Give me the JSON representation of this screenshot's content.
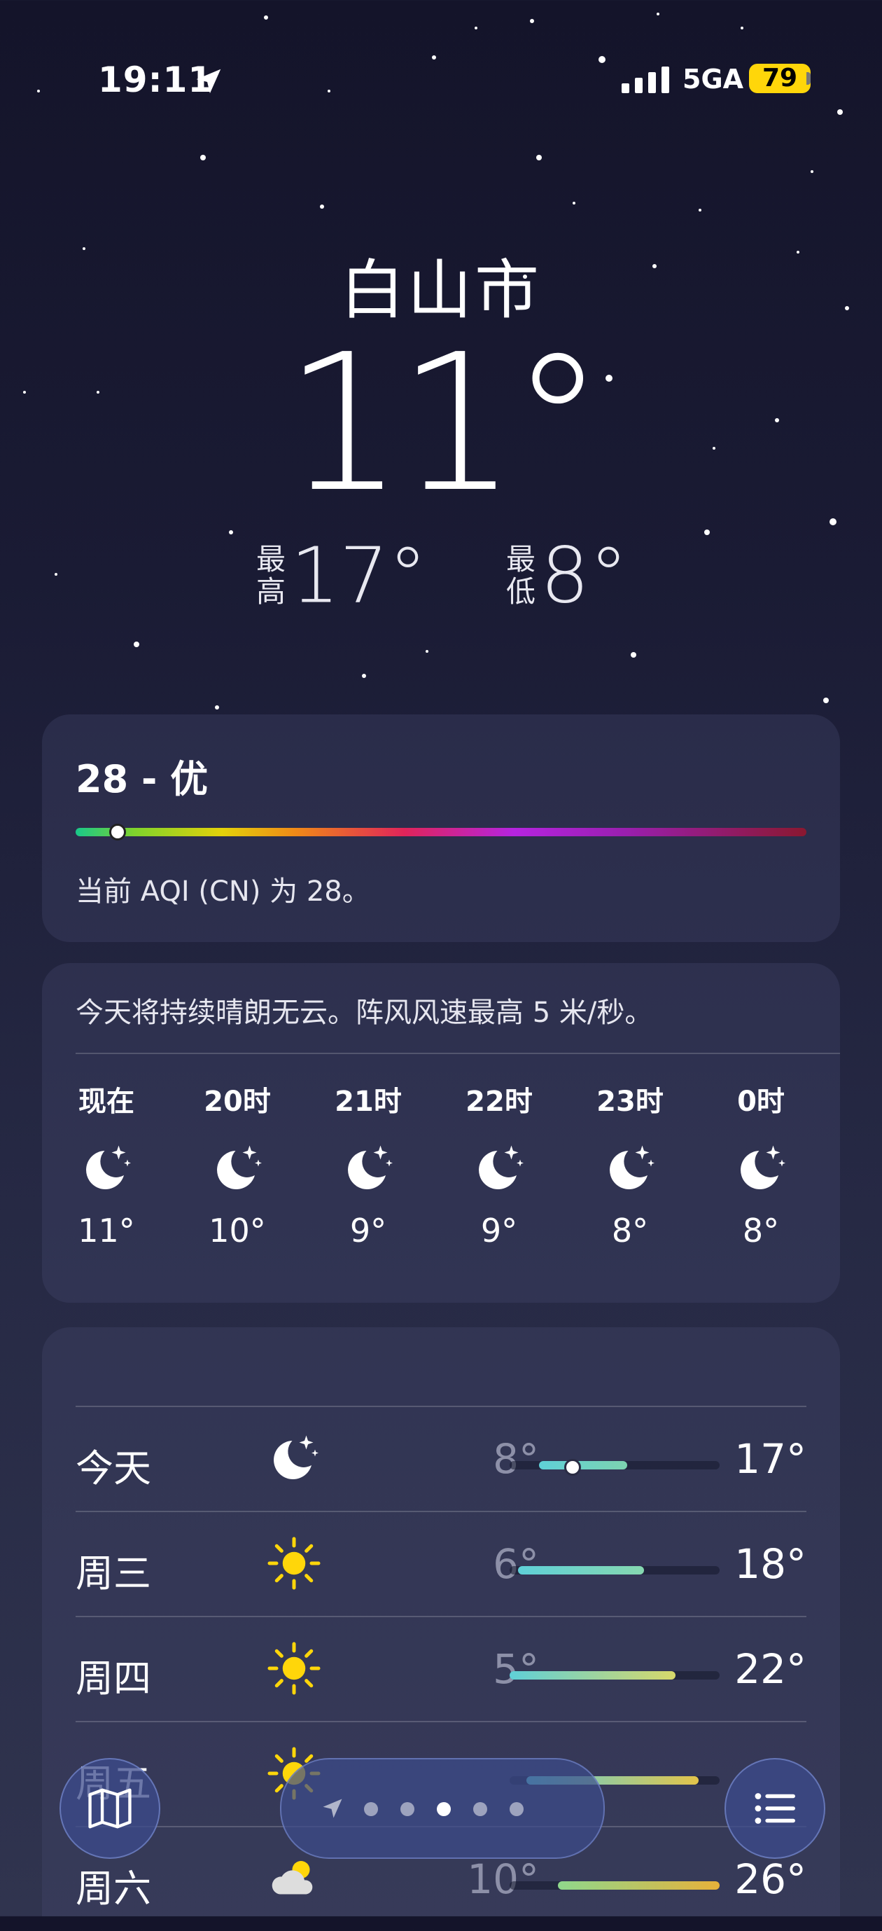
{
  "status": {
    "time": "19:11",
    "network": "5GA",
    "battery": "79"
  },
  "header": {
    "city": "白山市",
    "temp": "11°",
    "high_label": "最高",
    "high": "17°",
    "low_label": "最低",
    "low": "8°"
  },
  "aqi": {
    "title": "28 - 优",
    "description": "当前 AQI (CN) 为 28。",
    "level": 0.055
  },
  "hourly": {
    "summary": "今天将持续晴朗无云。阵风风速最高 5 米/秒。",
    "items": [
      {
        "label": "现在",
        "icon": "moon-stars-icon",
        "temp": "11°"
      },
      {
        "label": "20时",
        "icon": "moon-stars-icon",
        "temp": "10°"
      },
      {
        "label": "21时",
        "icon": "moon-stars-icon",
        "temp": "9°"
      },
      {
        "label": "22时",
        "icon": "moon-stars-icon",
        "temp": "9°"
      },
      {
        "label": "23时",
        "icon": "moon-stars-icon",
        "temp": "8°"
      },
      {
        "label": "0时",
        "icon": "moon-stars-icon",
        "temp": "8°"
      }
    ]
  },
  "daily": {
    "items": [
      {
        "day": "今天",
        "icon": "moon-stars-icon",
        "low": "8°",
        "high": "17°"
      },
      {
        "day": "周三",
        "icon": "sun-icon",
        "low": "6°",
        "high": "18°"
      },
      {
        "day": "周四",
        "icon": "sun-icon",
        "low": "5°",
        "high": "22°"
      },
      {
        "day": "周五",
        "icon": "sun-icon",
        "low": "",
        "high": ""
      },
      {
        "day": "周六",
        "icon": "partly-cloudy-icon",
        "low": "10°",
        "high": "26°"
      }
    ]
  },
  "pager": {
    "pages": 6,
    "current": 3
  },
  "colors": {
    "battery": "#ffd60a",
    "sun": "#ffd60a"
  }
}
